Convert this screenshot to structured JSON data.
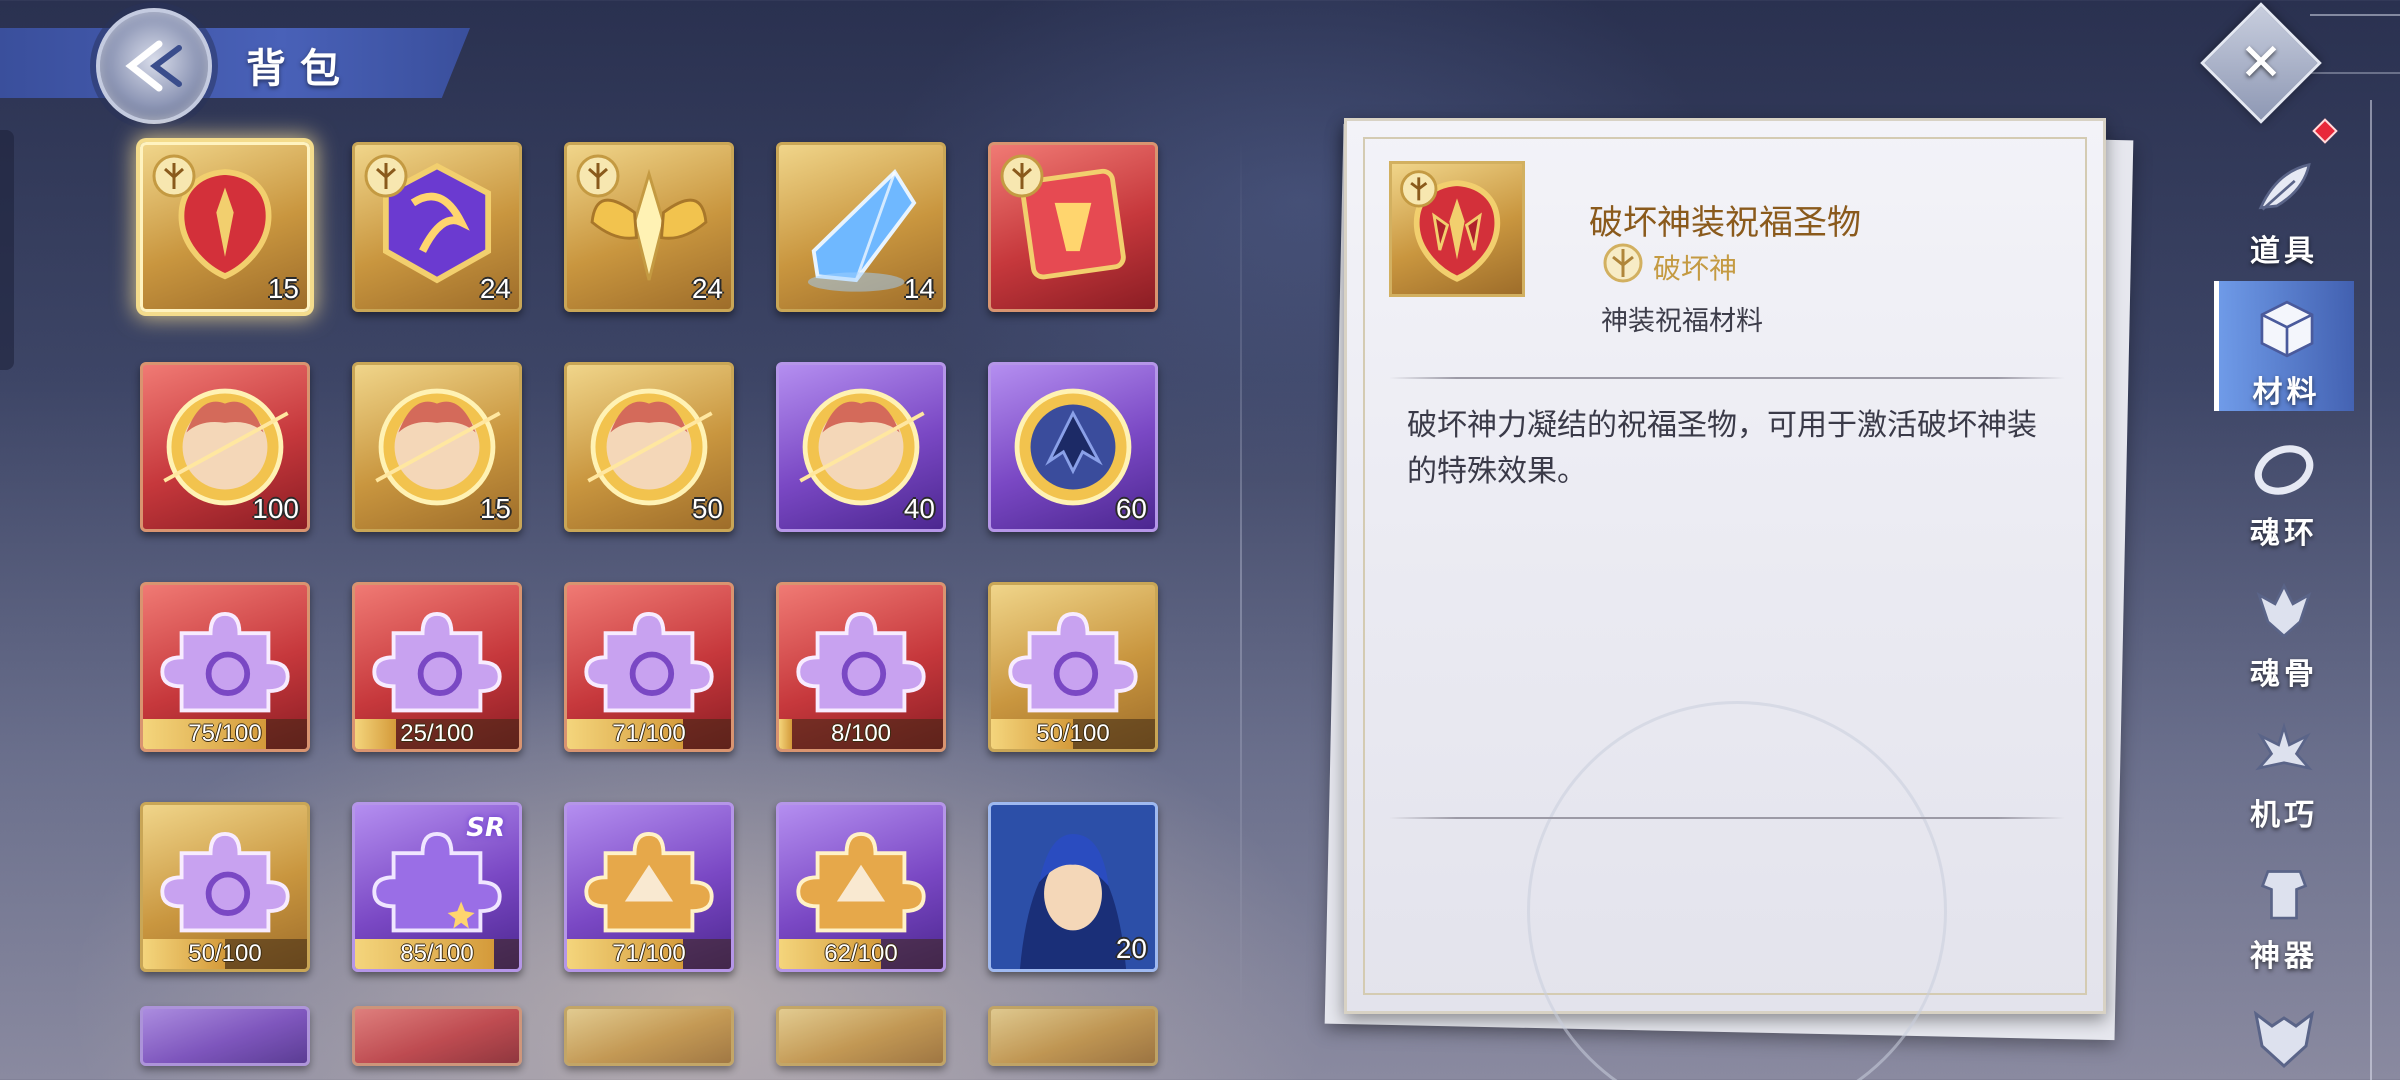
{
  "header": {
    "title": "背包"
  },
  "colors": {
    "accent_gold": "#c9963f",
    "header_blue": "#4961b8",
    "name_brown": "#8a5a1c",
    "active_tab": "#6ea0ff"
  },
  "grid": {
    "rows": [
      [
        {
          "type": "gold",
          "icon": "god-equip-emblem-icon",
          "count": "15",
          "selected": true
        },
        {
          "type": "gold",
          "icon": "purple-crest-icon",
          "count": "24"
        },
        {
          "type": "gold",
          "icon": "golden-wings-icon",
          "count": "24"
        },
        {
          "type": "gold",
          "icon": "blue-crystal-icon",
          "count": "14"
        },
        {
          "type": "red",
          "icon": "red-relic-icon",
          "count": ""
        }
      ],
      [
        {
          "type": "red",
          "icon": "portrait-medal-icon",
          "count": "100"
        },
        {
          "type": "gold",
          "icon": "portrait-medal-icon",
          "count": "15"
        },
        {
          "type": "gold",
          "icon": "portrait-medal-icon",
          "count": "50"
        },
        {
          "type": "purple",
          "icon": "portrait-medal-icon",
          "count": "40"
        },
        {
          "type": "purple",
          "icon": "dragon-medal-icon",
          "count": "60"
        }
      ],
      [
        {
          "type": "red",
          "icon": "puzzle-piece-icon",
          "progress": "75/100",
          "fill": 0.75
        },
        {
          "type": "red",
          "icon": "puzzle-piece-icon",
          "progress": "25/100",
          "fill": 0.25
        },
        {
          "type": "red",
          "icon": "puzzle-piece-icon",
          "progress": "71/100",
          "fill": 0.71
        },
        {
          "type": "red",
          "icon": "puzzle-piece-icon",
          "progress": "8/100",
          "fill": 0.08
        },
        {
          "type": "gold",
          "icon": "puzzle-piece-icon",
          "progress": "50/100",
          "fill": 0.5
        }
      ],
      [
        {
          "type": "gold",
          "icon": "puzzle-piece-icon",
          "progress": "50/100",
          "fill": 0.5
        },
        {
          "type": "purple",
          "icon": "sr-puzzle-icon",
          "progress": "85/100",
          "fill": 0.85,
          "tag": "SR"
        },
        {
          "type": "purple",
          "icon": "gold-puzzle-icon",
          "progress": "71/100",
          "fill": 0.71
        },
        {
          "type": "purple",
          "icon": "gold-puzzle-icon",
          "progress": "62/100",
          "fill": 0.62
        },
        {
          "type": "blue-portrait",
          "icon": "hero-portrait-icon",
          "count": "20"
        }
      ]
    ]
  },
  "detail": {
    "name": "破坏神装祝福圣物",
    "type_label": "破坏神",
    "category": "神装祝福材料",
    "description": "破坏神力凝结的祝福圣物，可用于激活破坏神装的特殊效果。"
  },
  "sidebar": {
    "items": [
      {
        "label": "道具",
        "icon": "feather-icon",
        "active": false
      },
      {
        "label": "材料",
        "icon": "crystal-cube-icon",
        "active": true
      },
      {
        "label": "魂环",
        "icon": "soul-ring-icon",
        "active": false
      },
      {
        "label": "魂骨",
        "icon": "soul-bone-icon",
        "active": false
      },
      {
        "label": "机巧",
        "icon": "mechanism-icon",
        "active": false
      },
      {
        "label": "神器",
        "icon": "artifact-icon",
        "active": false
      },
      {
        "label": "",
        "icon": "demon-mask-icon",
        "active": false
      }
    ]
  }
}
